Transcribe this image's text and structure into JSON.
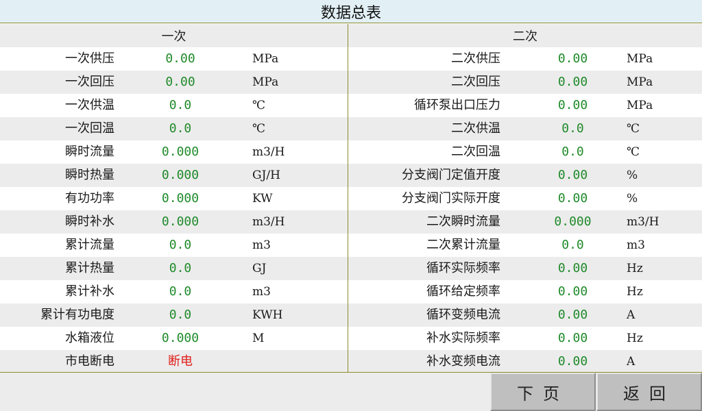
{
  "title": "数据总表",
  "primary": {
    "header": "一次",
    "rows": [
      {
        "label": "一次供压",
        "value": "0.00",
        "unit": "MPa"
      },
      {
        "label": "一次回压",
        "value": "0.00",
        "unit": "MPa"
      },
      {
        "label": "一次供温",
        "value": "0.0",
        "unit": "℃"
      },
      {
        "label": "一次回温",
        "value": "0.0",
        "unit": "℃"
      },
      {
        "label": "瞬时流量",
        "value": "0.000",
        "unit": "m3/H"
      },
      {
        "label": "瞬时热量",
        "value": "0.000",
        "unit": "GJ/H"
      },
      {
        "label": "有功功率",
        "value": "0.000",
        "unit": "KW"
      },
      {
        "label": "瞬时补水",
        "value": "0.000",
        "unit": "m3/H"
      },
      {
        "label": "累计流量",
        "value": "0.0",
        "unit": "m3"
      },
      {
        "label": "累计热量",
        "value": "0.0",
        "unit": "GJ"
      },
      {
        "label": "累计补水",
        "value": "0.0",
        "unit": "m3"
      },
      {
        "label": "累计有功电度",
        "value": "0.0",
        "unit": "KWH"
      },
      {
        "label": "水箱液位",
        "value": "0.000",
        "unit": "M"
      },
      {
        "label": "市电断电",
        "value": "断电",
        "unit": ""
      }
    ]
  },
  "secondary": {
    "header": "二次",
    "rows": [
      {
        "label": "二次供压",
        "value": "0.00",
        "unit": "MPa"
      },
      {
        "label": "二次回压",
        "value": "0.00",
        "unit": "MPa"
      },
      {
        "label": "循环泵出口压力",
        "value": "0.00",
        "unit": "MPa"
      },
      {
        "label": "二次供温",
        "value": "0.0",
        "unit": "℃"
      },
      {
        "label": "二次回温",
        "value": "0.0",
        "unit": "℃"
      },
      {
        "label": "分支阀门定值开度",
        "value": "0.00",
        "unit": "%"
      },
      {
        "label": "分支阀门实际开度",
        "value": "0.00",
        "unit": "%"
      },
      {
        "label": "二次瞬时流量",
        "value": "0.000",
        "unit": "m3/H"
      },
      {
        "label": "二次累计流量",
        "value": "0.0",
        "unit": "m3"
      },
      {
        "label": "循环实际频率",
        "value": "0.00",
        "unit": "Hz"
      },
      {
        "label": "循环给定频率",
        "value": "0.00",
        "unit": "Hz"
      },
      {
        "label": "循环变频电流",
        "value": "0.00",
        "unit": "A"
      },
      {
        "label": "补水实际频率",
        "value": "0.00",
        "unit": "Hz"
      },
      {
        "label": "补水变频电流",
        "value": "0.00",
        "unit": "A"
      }
    ]
  },
  "buttons": {
    "next_label": "下页",
    "back_label": "返回"
  },
  "colors": {
    "value_green": "#1f8a2a",
    "alarm_red": "#e0201c",
    "title_bg": "#e2f0f6"
  }
}
